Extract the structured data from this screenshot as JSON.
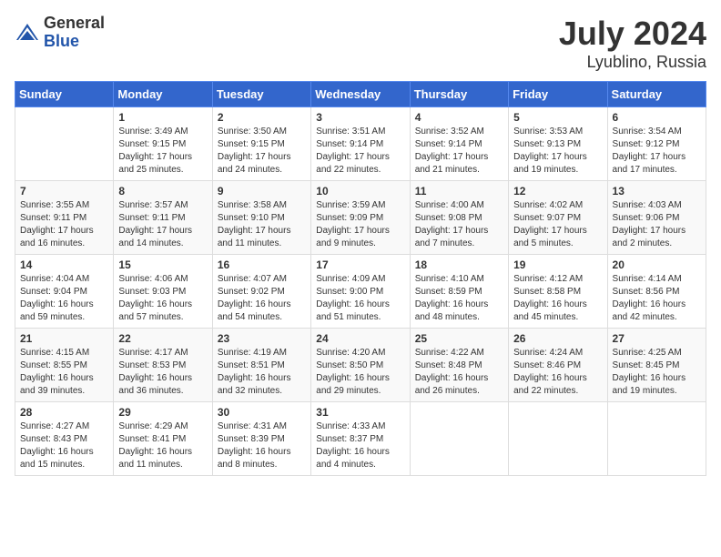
{
  "header": {
    "logo_general": "General",
    "logo_blue": "Blue",
    "title": "July 2024",
    "subtitle": "Lyublino, Russia"
  },
  "weekdays": [
    "Sunday",
    "Monday",
    "Tuesday",
    "Wednesday",
    "Thursday",
    "Friday",
    "Saturday"
  ],
  "weeks": [
    [
      {
        "day": "",
        "info": ""
      },
      {
        "day": "1",
        "info": "Sunrise: 3:49 AM\nSunset: 9:15 PM\nDaylight: 17 hours\nand 25 minutes."
      },
      {
        "day": "2",
        "info": "Sunrise: 3:50 AM\nSunset: 9:15 PM\nDaylight: 17 hours\nand 24 minutes."
      },
      {
        "day": "3",
        "info": "Sunrise: 3:51 AM\nSunset: 9:14 PM\nDaylight: 17 hours\nand 22 minutes."
      },
      {
        "day": "4",
        "info": "Sunrise: 3:52 AM\nSunset: 9:14 PM\nDaylight: 17 hours\nand 21 minutes."
      },
      {
        "day": "5",
        "info": "Sunrise: 3:53 AM\nSunset: 9:13 PM\nDaylight: 17 hours\nand 19 minutes."
      },
      {
        "day": "6",
        "info": "Sunrise: 3:54 AM\nSunset: 9:12 PM\nDaylight: 17 hours\nand 17 minutes."
      }
    ],
    [
      {
        "day": "7",
        "info": "Sunrise: 3:55 AM\nSunset: 9:11 PM\nDaylight: 17 hours\nand 16 minutes."
      },
      {
        "day": "8",
        "info": "Sunrise: 3:57 AM\nSunset: 9:11 PM\nDaylight: 17 hours\nand 14 minutes."
      },
      {
        "day": "9",
        "info": "Sunrise: 3:58 AM\nSunset: 9:10 PM\nDaylight: 17 hours\nand 11 minutes."
      },
      {
        "day": "10",
        "info": "Sunrise: 3:59 AM\nSunset: 9:09 PM\nDaylight: 17 hours\nand 9 minutes."
      },
      {
        "day": "11",
        "info": "Sunrise: 4:00 AM\nSunset: 9:08 PM\nDaylight: 17 hours\nand 7 minutes."
      },
      {
        "day": "12",
        "info": "Sunrise: 4:02 AM\nSunset: 9:07 PM\nDaylight: 17 hours\nand 5 minutes."
      },
      {
        "day": "13",
        "info": "Sunrise: 4:03 AM\nSunset: 9:06 PM\nDaylight: 17 hours\nand 2 minutes."
      }
    ],
    [
      {
        "day": "14",
        "info": "Sunrise: 4:04 AM\nSunset: 9:04 PM\nDaylight: 16 hours\nand 59 minutes."
      },
      {
        "day": "15",
        "info": "Sunrise: 4:06 AM\nSunset: 9:03 PM\nDaylight: 16 hours\nand 57 minutes."
      },
      {
        "day": "16",
        "info": "Sunrise: 4:07 AM\nSunset: 9:02 PM\nDaylight: 16 hours\nand 54 minutes."
      },
      {
        "day": "17",
        "info": "Sunrise: 4:09 AM\nSunset: 9:00 PM\nDaylight: 16 hours\nand 51 minutes."
      },
      {
        "day": "18",
        "info": "Sunrise: 4:10 AM\nSunset: 8:59 PM\nDaylight: 16 hours\nand 48 minutes."
      },
      {
        "day": "19",
        "info": "Sunrise: 4:12 AM\nSunset: 8:58 PM\nDaylight: 16 hours\nand 45 minutes."
      },
      {
        "day": "20",
        "info": "Sunrise: 4:14 AM\nSunset: 8:56 PM\nDaylight: 16 hours\nand 42 minutes."
      }
    ],
    [
      {
        "day": "21",
        "info": "Sunrise: 4:15 AM\nSunset: 8:55 PM\nDaylight: 16 hours\nand 39 minutes."
      },
      {
        "day": "22",
        "info": "Sunrise: 4:17 AM\nSunset: 8:53 PM\nDaylight: 16 hours\nand 36 minutes."
      },
      {
        "day": "23",
        "info": "Sunrise: 4:19 AM\nSunset: 8:51 PM\nDaylight: 16 hours\nand 32 minutes."
      },
      {
        "day": "24",
        "info": "Sunrise: 4:20 AM\nSunset: 8:50 PM\nDaylight: 16 hours\nand 29 minutes."
      },
      {
        "day": "25",
        "info": "Sunrise: 4:22 AM\nSunset: 8:48 PM\nDaylight: 16 hours\nand 26 minutes."
      },
      {
        "day": "26",
        "info": "Sunrise: 4:24 AM\nSunset: 8:46 PM\nDaylight: 16 hours\nand 22 minutes."
      },
      {
        "day": "27",
        "info": "Sunrise: 4:25 AM\nSunset: 8:45 PM\nDaylight: 16 hours\nand 19 minutes."
      }
    ],
    [
      {
        "day": "28",
        "info": "Sunrise: 4:27 AM\nSunset: 8:43 PM\nDaylight: 16 hours\nand 15 minutes."
      },
      {
        "day": "29",
        "info": "Sunrise: 4:29 AM\nSunset: 8:41 PM\nDaylight: 16 hours\nand 11 minutes."
      },
      {
        "day": "30",
        "info": "Sunrise: 4:31 AM\nSunset: 8:39 PM\nDaylight: 16 hours\nand 8 minutes."
      },
      {
        "day": "31",
        "info": "Sunrise: 4:33 AM\nSunset: 8:37 PM\nDaylight: 16 hours\nand 4 minutes."
      },
      {
        "day": "",
        "info": ""
      },
      {
        "day": "",
        "info": ""
      },
      {
        "day": "",
        "info": ""
      }
    ]
  ]
}
